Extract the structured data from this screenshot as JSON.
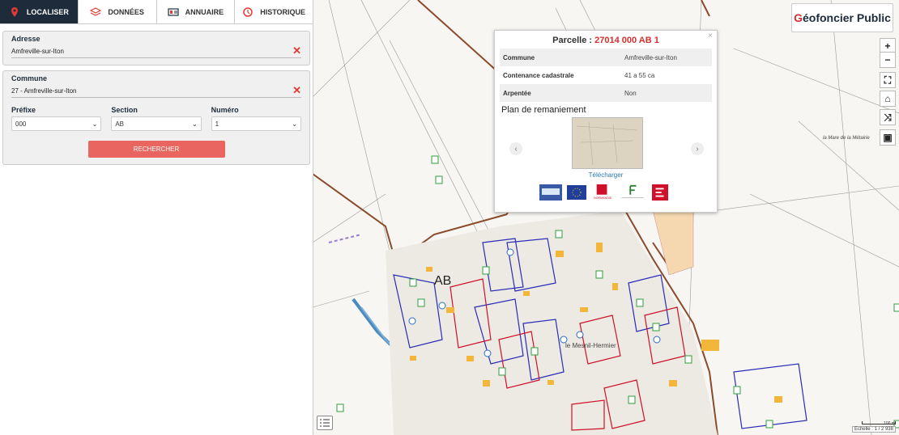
{
  "tabs": [
    {
      "label": "LOCALISER",
      "icon": "map-pin-icon",
      "active": true
    },
    {
      "label": "DONNÉES",
      "icon": "layers-icon"
    },
    {
      "label": "ANNUAIRE",
      "icon": "directory-icon"
    },
    {
      "label": "HISTORIQUE",
      "icon": "history-icon"
    }
  ],
  "adresse": {
    "label": "Adresse",
    "value": "Amfreville-sur-Iton"
  },
  "commune": {
    "label": "Commune",
    "value": "27 - Amfreville-sur-Iton"
  },
  "prefixe": {
    "label": "Préfixe",
    "value": "000"
  },
  "section": {
    "label": "Section",
    "value": "AB"
  },
  "numero": {
    "label": "Numéro",
    "value": "1"
  },
  "search_button": "RECHERCHER",
  "brand": {
    "prefix": "G",
    "rest": "éofoncier Public"
  },
  "map_controls": {
    "zoom_in": "+",
    "zoom_out": "−"
  },
  "map_labels": {
    "place_top_right": "la Mare de la Métairie",
    "section": "AB",
    "village": "le Mesnil-Hermier"
  },
  "scale": {
    "bar": "100 m",
    "text": "Echelle : 1 / 2 938"
  },
  "popup": {
    "title_prefix": "Parcelle : ",
    "title_number": "27014 000 AB 1",
    "close": "×",
    "rows": [
      {
        "key": "Commune",
        "value": "Amfreville-sur-Iton"
      },
      {
        "key": "Contenance cadastrale",
        "value": "41 a 55 ca"
      },
      {
        "key": "Arpentée",
        "value": "Non"
      }
    ],
    "plan_title": "Plan de remaniement",
    "download": "Télécharger"
  },
  "colors": {
    "accent": "#1d2b3a",
    "brand_red": "#d32f2f",
    "button": "#e8665f",
    "parcel_red": "#d0102a",
    "parcel_blue": "#2b2bb8",
    "road": "#8b4a2b"
  }
}
